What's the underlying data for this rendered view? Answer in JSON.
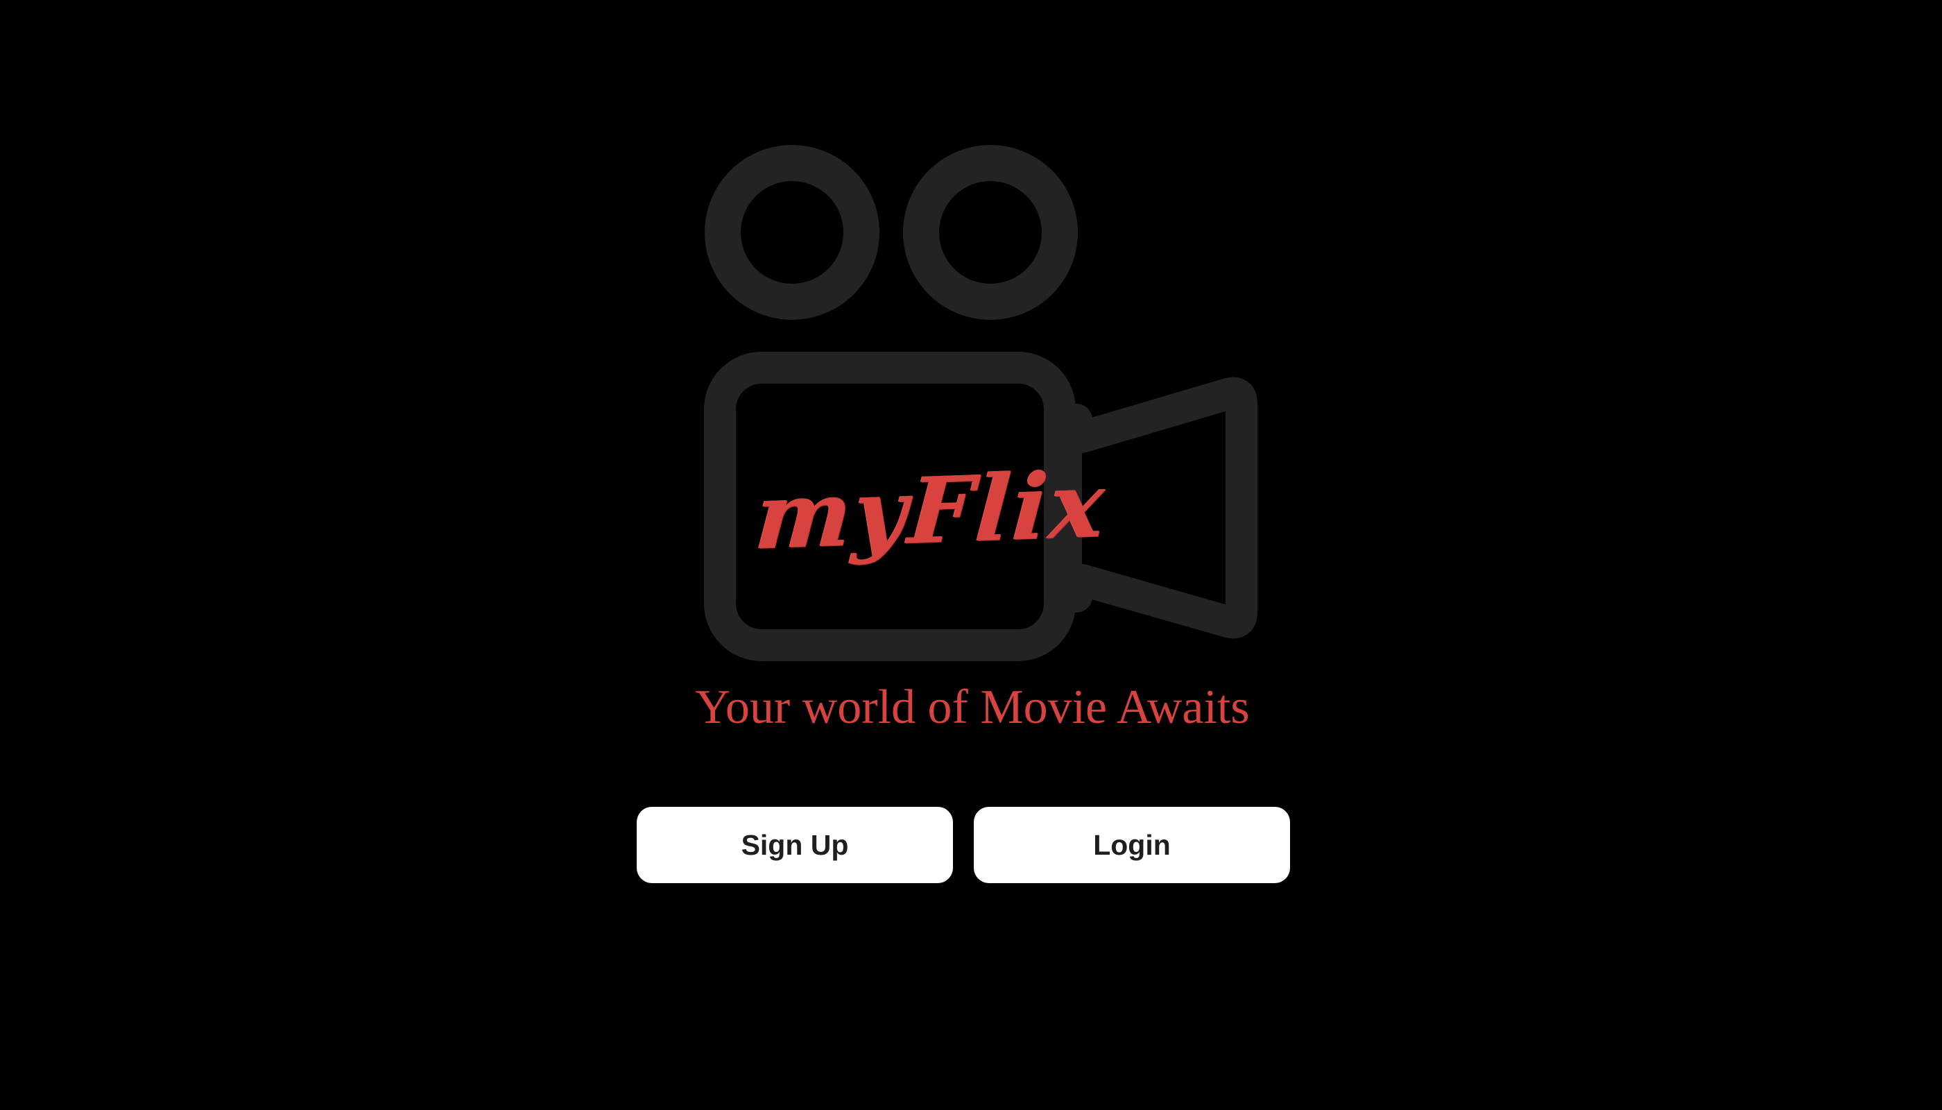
{
  "brand": {
    "logo_word": "myFlix",
    "tagline": "Your world of Movie Awaits",
    "icon": "movie-camera-icon",
    "camera_color": "#242222",
    "accent_color": "#d9433f",
    "background_color": "#000000"
  },
  "actions": {
    "signup_label": "Sign Up",
    "login_label": "Login"
  }
}
